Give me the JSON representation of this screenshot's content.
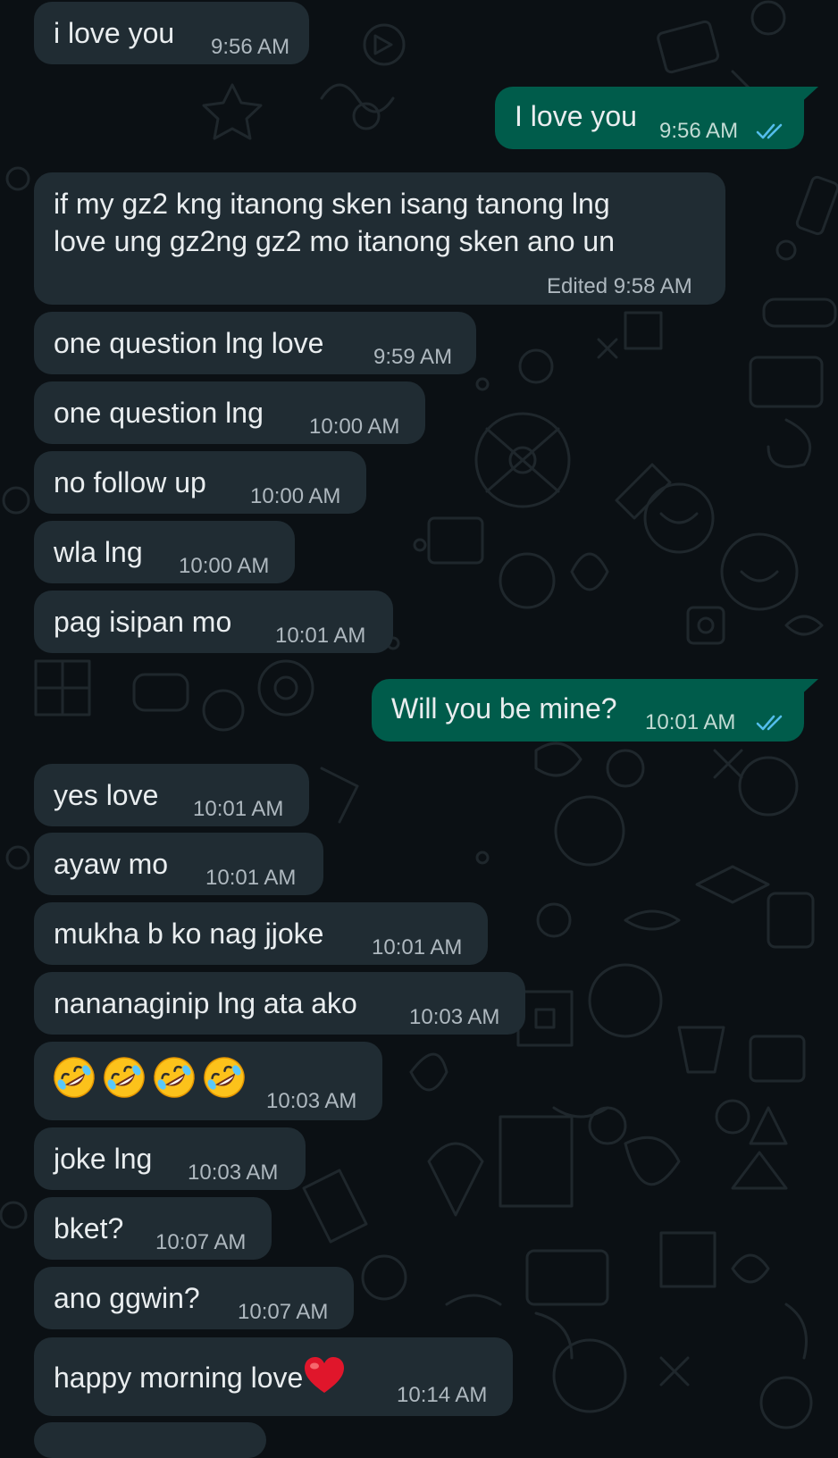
{
  "theme": {
    "background": "#0b1014",
    "incoming_bubble": "#202c33",
    "outgoing_bubble": "#005c4b",
    "read_tick": "#53bdeb",
    "text": "#e9edef"
  },
  "messages": [
    {
      "dir": "in",
      "text": "i love you",
      "time": "9:56 AM"
    },
    {
      "dir": "out",
      "text": "I love you",
      "time": "9:56 AM",
      "status": "read"
    },
    {
      "dir": "in",
      "lines": [
        "if my gz2 kng itanong sken isang tanong lng",
        "love ung gz2ng gz2 mo itanong sken ano un"
      ],
      "time": "Edited 9:58 AM"
    },
    {
      "dir": "in",
      "text": "one question lng love",
      "time": "9:59 AM"
    },
    {
      "dir": "in",
      "text": "one question lng",
      "time": "10:00 AM"
    },
    {
      "dir": "in",
      "text": "no follow up",
      "time": "10:00 AM"
    },
    {
      "dir": "in",
      "text": "wla lng",
      "time": "10:00 AM"
    },
    {
      "dir": "in",
      "text": "pag isipan mo",
      "time": "10:01 AM"
    },
    {
      "dir": "out",
      "text": "Will you be mine?",
      "time": "10:01 AM",
      "status": "read"
    },
    {
      "dir": "in",
      "text": "yes love",
      "time": "10:01 AM"
    },
    {
      "dir": "in",
      "text": "ayaw mo",
      "time": "10:01 AM"
    },
    {
      "dir": "in",
      "text": "mukha b ko nag jjoke",
      "time": "10:01 AM"
    },
    {
      "dir": "in",
      "text": "nananaginip lng ata ako",
      "time": "10:03 AM"
    },
    {
      "dir": "in",
      "emoji": [
        "rolling-on-floor-laughing",
        "rolling-on-floor-laughing",
        "rolling-on-floor-laughing",
        "rolling-on-floor-laughing"
      ],
      "time": "10:03 AM"
    },
    {
      "dir": "in",
      "text": "joke lng",
      "time": "10:03 AM"
    },
    {
      "dir": "in",
      "text": "bket?",
      "time": "10:07 AM"
    },
    {
      "dir": "in",
      "text": "ano ggwin?",
      "time": "10:07 AM"
    },
    {
      "dir": "in",
      "text": "happy morning love",
      "trailing_emoji": "red-heart",
      "time": "10:14 AM"
    }
  ]
}
